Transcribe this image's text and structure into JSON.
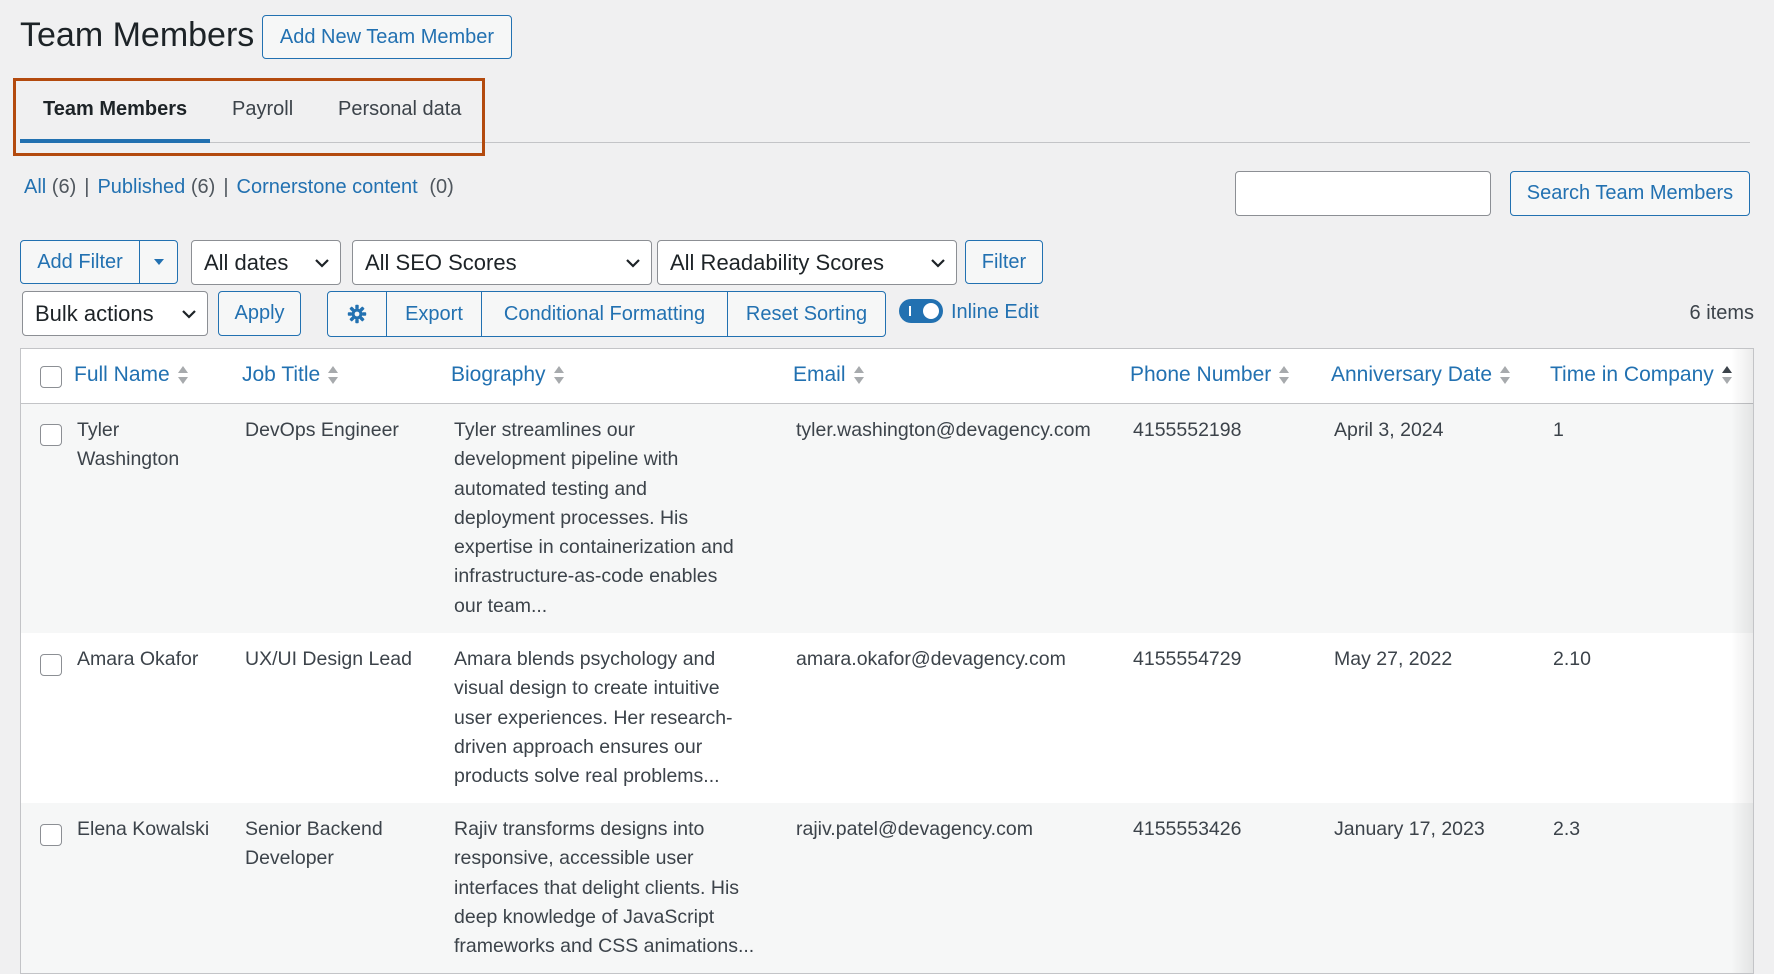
{
  "page": {
    "title": "Team Members",
    "add_new_label": "Add New Team Member"
  },
  "tabs": [
    {
      "label": "Team Members",
      "active": true
    },
    {
      "label": "Payroll",
      "active": false
    },
    {
      "label": "Personal data",
      "active": false
    }
  ],
  "views": {
    "all": {
      "label": "All",
      "count": "(6)"
    },
    "published": {
      "label": "Published",
      "count": "(6)"
    },
    "cornerstone": {
      "label": "Cornerstone content",
      "count": "(0)"
    },
    "separator": "|"
  },
  "search": {
    "value": "",
    "button_label": "Search Team Members"
  },
  "filters": {
    "add_filter_label": "Add Filter",
    "dates": "All dates",
    "seo": "All SEO Scores",
    "readability": "All Readability Scores",
    "filter_button": "Filter"
  },
  "actions": {
    "bulk": "Bulk actions",
    "apply": "Apply",
    "export": "Export",
    "conditional_formatting": "Conditional Formatting",
    "reset_sorting": "Reset Sorting",
    "inline_edit": "Inline Edit",
    "inline_edit_on": true,
    "items_count": "6 items"
  },
  "table": {
    "columns": [
      "Full Name",
      "Job Title",
      "Biography",
      "Email",
      "Phone Number",
      "Anniversary Date",
      "Time in Company"
    ],
    "rows": [
      {
        "name_line1": "Tyler",
        "name_line2": "Washington",
        "job_line1": "DevOps Engineer",
        "job_line2": "",
        "bio": [
          "Tyler streamlines our",
          "development pipeline with",
          "automated testing and",
          "deployment processes. His",
          "expertise in containerization and",
          "infrastructure-as-code enables",
          "our team..."
        ],
        "email": "tyler.washington@devagency.com",
        "phone": "4155552198",
        "anniversary": "April 3, 2024",
        "time": "1"
      },
      {
        "name_line1": "Amara Okafor",
        "name_line2": "",
        "job_line1": "UX/UI Design Lead",
        "job_line2": "",
        "bio": [
          "Amara blends psychology and",
          "visual design to create intuitive",
          "user experiences. Her research-",
          "driven approach ensures our",
          "products solve real problems..."
        ],
        "email": "amara.okafor@devagency.com",
        "phone": "4155554729",
        "anniversary": "May 27, 2022",
        "time": "2.10"
      },
      {
        "name_line1": "Elena Kowalski",
        "name_line2": "",
        "job_line1": "Senior Backend",
        "job_line2": "Developer",
        "bio": [
          "Rajiv transforms designs into",
          "responsive, accessible user",
          "interfaces that delight clients. His",
          "deep knowledge of JavaScript",
          "frameworks and CSS animations..."
        ],
        "email": "rajiv.patel@devagency.com",
        "phone": "4155553426",
        "anniversary": "January 17, 2023",
        "time": "2.3"
      }
    ]
  },
  "colors": {
    "accent": "#2271b1",
    "highlight_border": "#b34a0e",
    "background": "#f0f0f1"
  }
}
